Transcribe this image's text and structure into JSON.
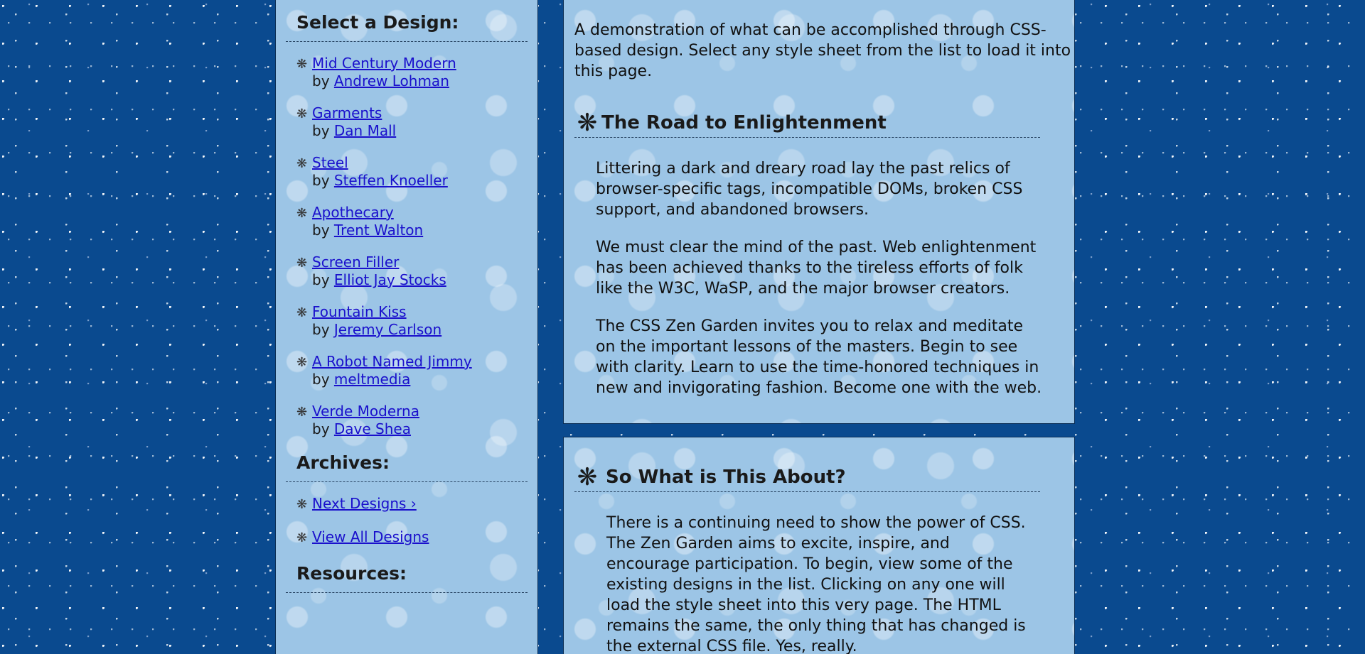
{
  "sidebar": {
    "select_heading": "Select a Design:",
    "designs": [
      {
        "title": "Mid Century Modern",
        "by": "by",
        "author": "Andrew Lohman"
      },
      {
        "title": "Garments",
        "by": "by",
        "author": "Dan Mall"
      },
      {
        "title": "Steel",
        "by": "by",
        "author": "Steffen Knoeller"
      },
      {
        "title": "Apothecary",
        "by": "by",
        "author": "Trent Walton"
      },
      {
        "title": "Screen Filler",
        "by": "by",
        "author": "Elliot Jay Stocks"
      },
      {
        "title": "Fountain Kiss",
        "by": "by",
        "author": "Jeremy Carlson"
      },
      {
        "title": "A Robot Named Jimmy",
        "by": "by",
        "author": "meltmedia"
      },
      {
        "title": "Verde Moderna",
        "by": "by",
        "author": "Dave Shea"
      }
    ],
    "archives_heading": "Archives:",
    "archives": [
      {
        "label": "Next Designs ›"
      },
      {
        "label": "View All Designs"
      }
    ],
    "resources_heading": "Resources:"
  },
  "intro": {
    "summary": "A demonstration of what can be accomplished through CSS-based design. Select any style sheet from the list to load it into this page.",
    "heading": "The Road to Enlightenment",
    "paragraphs": [
      "Littering a dark and dreary road lay the past relics of browser-specific tags, incompatible DOMs, broken CSS support, and abandoned browsers.",
      "We must clear the mind of the past. Web enlightenment has been achieved thanks to the tireless efforts of folk like the W3C, WaSP, and the major browser creators.",
      "The CSS Zen Garden invites you to relax and meditate on the important lessons of the masters. Begin to see with clarity. Learn to use the time-honored techniques in new and invigorating fashion. Become one with the web."
    ]
  },
  "about": {
    "heading": "So What is This About?",
    "paragraph": "There is a continuing need to show the power of CSS. The Zen Garden aims to excite, inspire, and encourage participation. To begin, view some of the existing designs in the list. Clicking on any one will load the style sheet into this very page. The HTML remains the same, the only thing that has changed is the external CSS file. Yes, really."
  },
  "icons": {
    "bullet": "snowflake-bullet-icon",
    "heading": "snowflake-heading-icon"
  },
  "colors": {
    "page_background": "#0a4a8f",
    "panel_background": "#9cc5e6",
    "link": "#1a10cc"
  }
}
